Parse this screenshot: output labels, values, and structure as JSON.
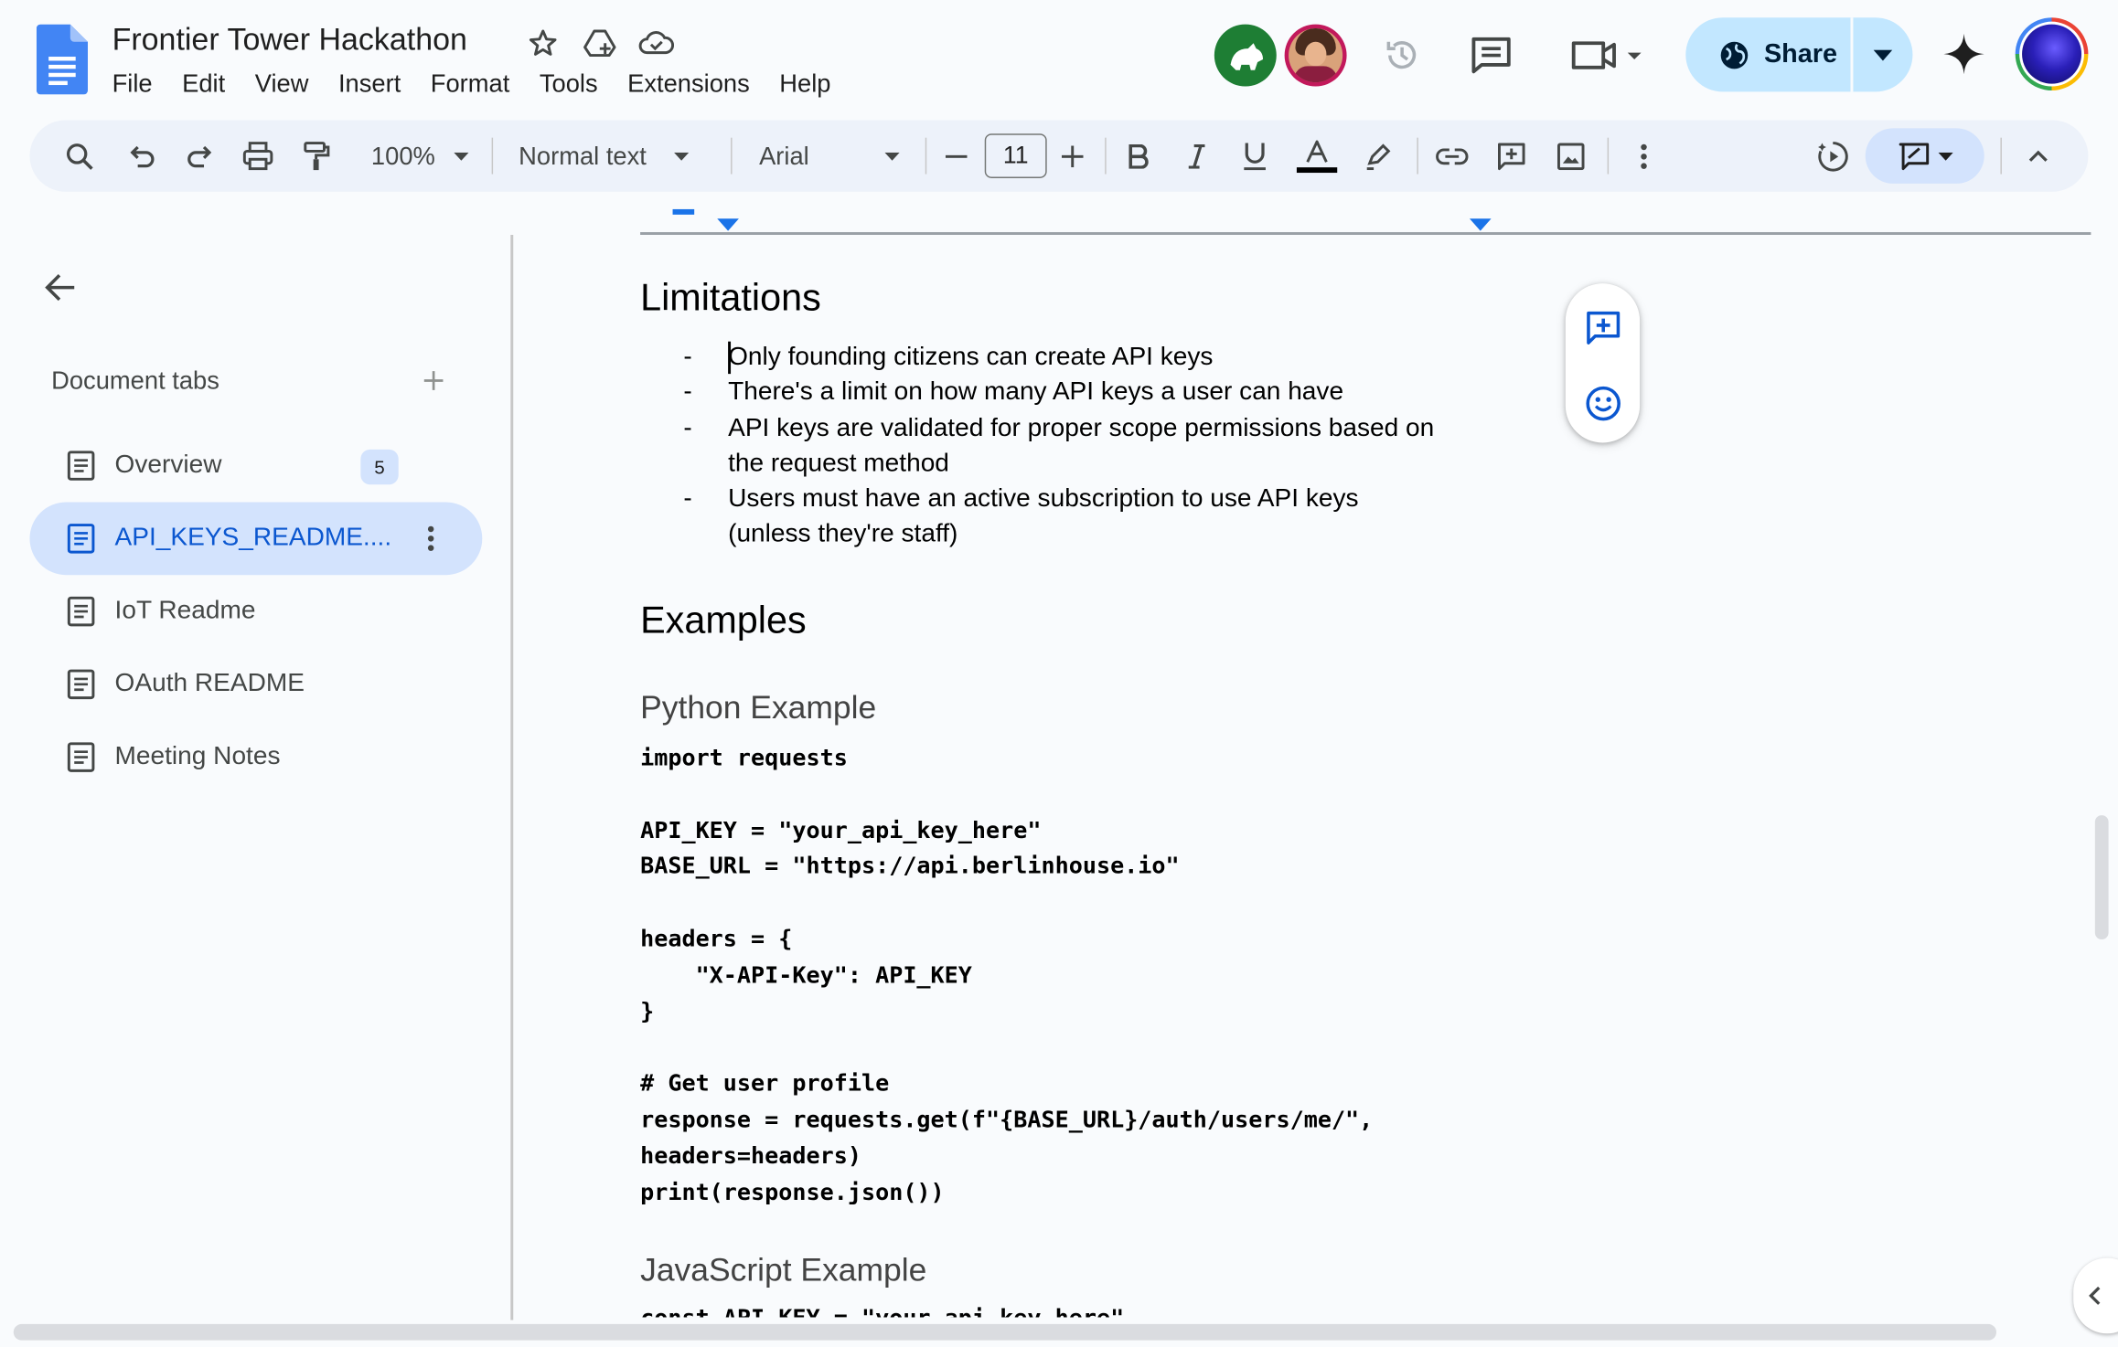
{
  "app": {
    "title": "Frontier Tower Hackathon",
    "menu": [
      "File",
      "Edit",
      "View",
      "Insert",
      "Format",
      "Tools",
      "Extensions",
      "Help"
    ],
    "share_label": "Share"
  },
  "toolbar": {
    "zoom": "100%",
    "style": "Normal text",
    "font": "Arial",
    "font_size": "11",
    "text_color": "#000000"
  },
  "sidebar": {
    "heading": "Document tabs",
    "tabs": [
      {
        "label": "Overview",
        "badge": "5"
      },
      {
        "label": "API_KEYS_README...."
      },
      {
        "label": "IoT Readme"
      },
      {
        "label": "OAuth README"
      },
      {
        "label": "Meeting Notes"
      }
    ]
  },
  "document": {
    "limitations_heading": "Limitations",
    "bullet_marker": "-",
    "limitations": [
      {
        "line1": "Only founding citizens can create API keys"
      },
      {
        "line1": "There's a limit on how many API keys a user can have"
      },
      {
        "line1": "API keys are validated for proper scope permissions based on",
        "line2": "the request method"
      },
      {
        "line1": "Users must have an active subscription to use API keys",
        "line2": "(unless they're staff)"
      }
    ],
    "examples_heading": "Examples",
    "python_heading": "Python Example",
    "python_code": [
      "import requests",
      "",
      "API_KEY = \"your_api_key_here\"",
      "BASE_URL = \"https://api.berlinhouse.io\"",
      "",
      "headers = {",
      "    \"X-API-Key\": API_KEY",
      "}",
      "",
      "# Get user profile",
      "response = requests.get(f\"{BASE_URL}/auth/users/me/\",",
      "headers=headers)",
      "print(response.json())"
    ],
    "javascript_heading": "JavaScript Example",
    "js_partial": "const API_KEY = \"your_api_key_here\""
  },
  "colors": {
    "accent": "#0b57d0",
    "share_bg": "#c2e7ff",
    "toolbar_bg": "#edf2fa",
    "active_tab_bg": "#d3e3fd"
  }
}
